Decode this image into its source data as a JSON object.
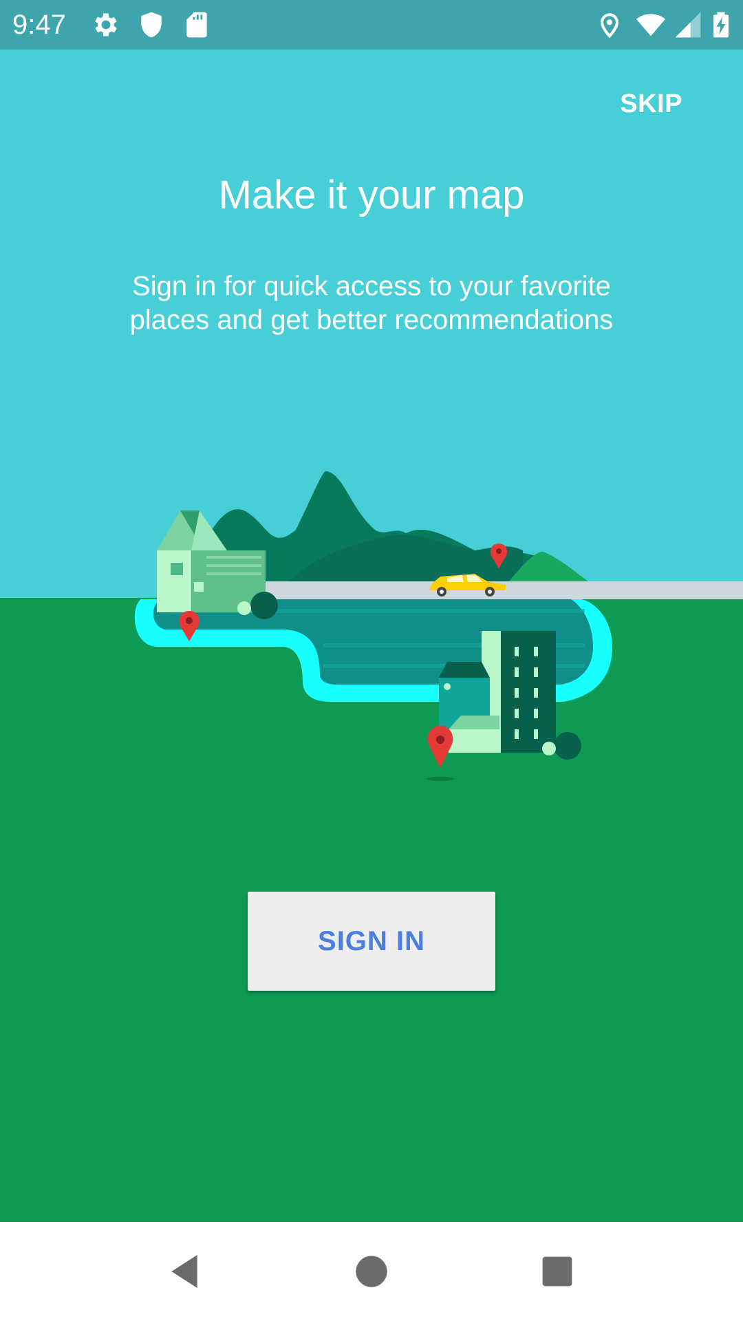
{
  "status_bar": {
    "time": "9:47",
    "left_icons": [
      "gear-icon",
      "shield-icon",
      "sd-card-icon"
    ],
    "right_icons": [
      "location-icon",
      "wifi-icon",
      "signal-icon",
      "battery-charging-icon"
    ]
  },
  "header": {
    "skip_label": "SKIP"
  },
  "main": {
    "title": "Make it your map",
    "subtitle": "Sign in for quick access to your favorite places and get better recommendations",
    "illustration": "town-map-illustration",
    "sign_in_label": "SIGN IN"
  },
  "nav_bar": {
    "icons": [
      "back-icon",
      "home-icon",
      "recents-icon"
    ]
  },
  "colors": {
    "status_bar": "#3ea5ad",
    "sky": "#46cfd6",
    "ground": "#0e9a52",
    "button_text": "#4a7fe0",
    "button_bg": "#eeeeee"
  }
}
